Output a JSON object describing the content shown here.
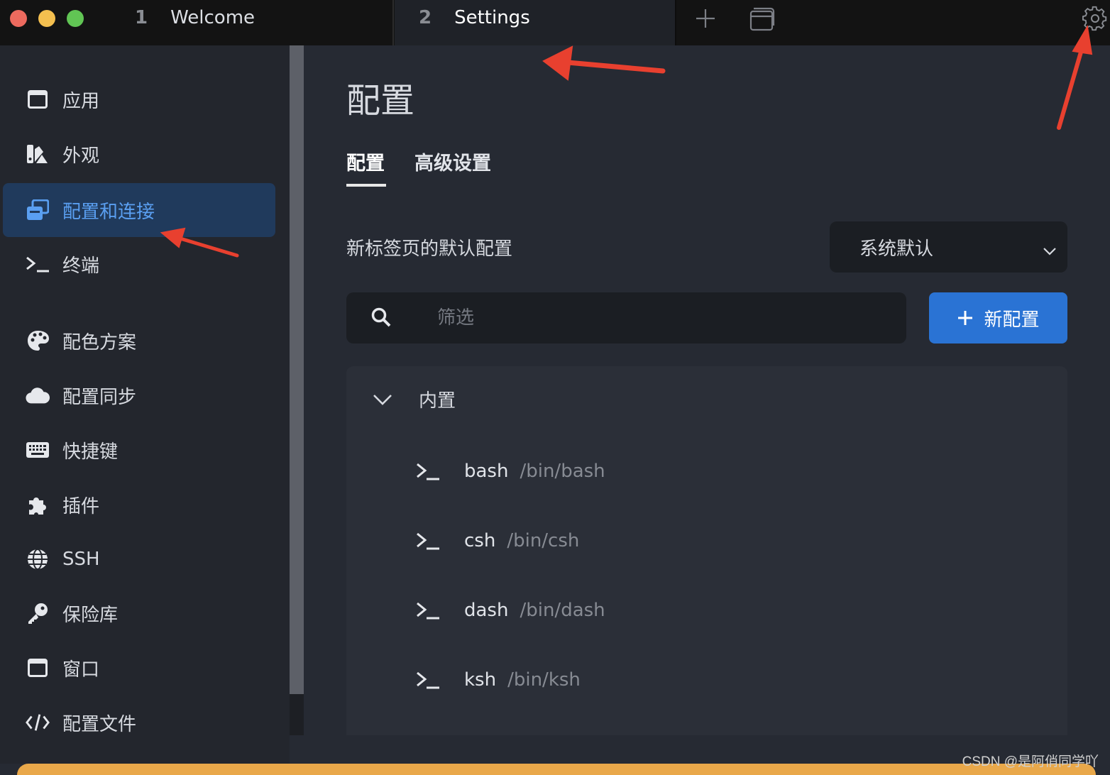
{
  "tabs": [
    {
      "number": "1",
      "title": "Welcome"
    },
    {
      "number": "2",
      "title": "Settings"
    }
  ],
  "toolbar_icons": [
    "plus-icon",
    "window-icon",
    "gear-icon"
  ],
  "sidebar": {
    "items": [
      {
        "label": "应用",
        "icon": "window-icon"
      },
      {
        "label": "外观",
        "icon": "appearance-icon"
      },
      {
        "label": "配置和连接",
        "icon": "profiles-icon",
        "active": true
      },
      {
        "label": "终端",
        "icon": "terminal-icon"
      },
      {
        "label": "配色方案",
        "icon": "palette-icon"
      },
      {
        "label": "配置同步",
        "icon": "cloud-icon"
      },
      {
        "label": "快捷键",
        "icon": "keyboard-icon"
      },
      {
        "label": "插件",
        "icon": "puzzle-icon"
      },
      {
        "label": "SSH",
        "icon": "globe-icon"
      },
      {
        "label": "保险库",
        "icon": "key-icon"
      },
      {
        "label": "窗口",
        "icon": "window-icon"
      },
      {
        "label": "配置文件",
        "icon": "code-icon"
      }
    ]
  },
  "main": {
    "title": "配置",
    "subtabs": [
      "配置",
      "高级设置"
    ],
    "default_profile_label": "新标签页的默认配置",
    "default_profile_value": "系统默认",
    "filter_placeholder": "筛选",
    "new_button_label": "新配置",
    "group": {
      "name": "内置",
      "profiles": [
        {
          "name": "bash",
          "path": "/bin/bash"
        },
        {
          "name": "csh",
          "path": "/bin/csh"
        },
        {
          "name": "dash",
          "path": "/bin/dash"
        },
        {
          "name": "ksh",
          "path": "/bin/ksh"
        }
      ]
    }
  },
  "watermark": "CSDN @是阿俏同学吖",
  "colors": {
    "accent": "#2a73d4",
    "active_nav_bg": "#203a5c",
    "active_nav_text": "#5a9ff1",
    "annotation_arrow": "#e8402f",
    "bottom_banner": "#e9a84a"
  }
}
